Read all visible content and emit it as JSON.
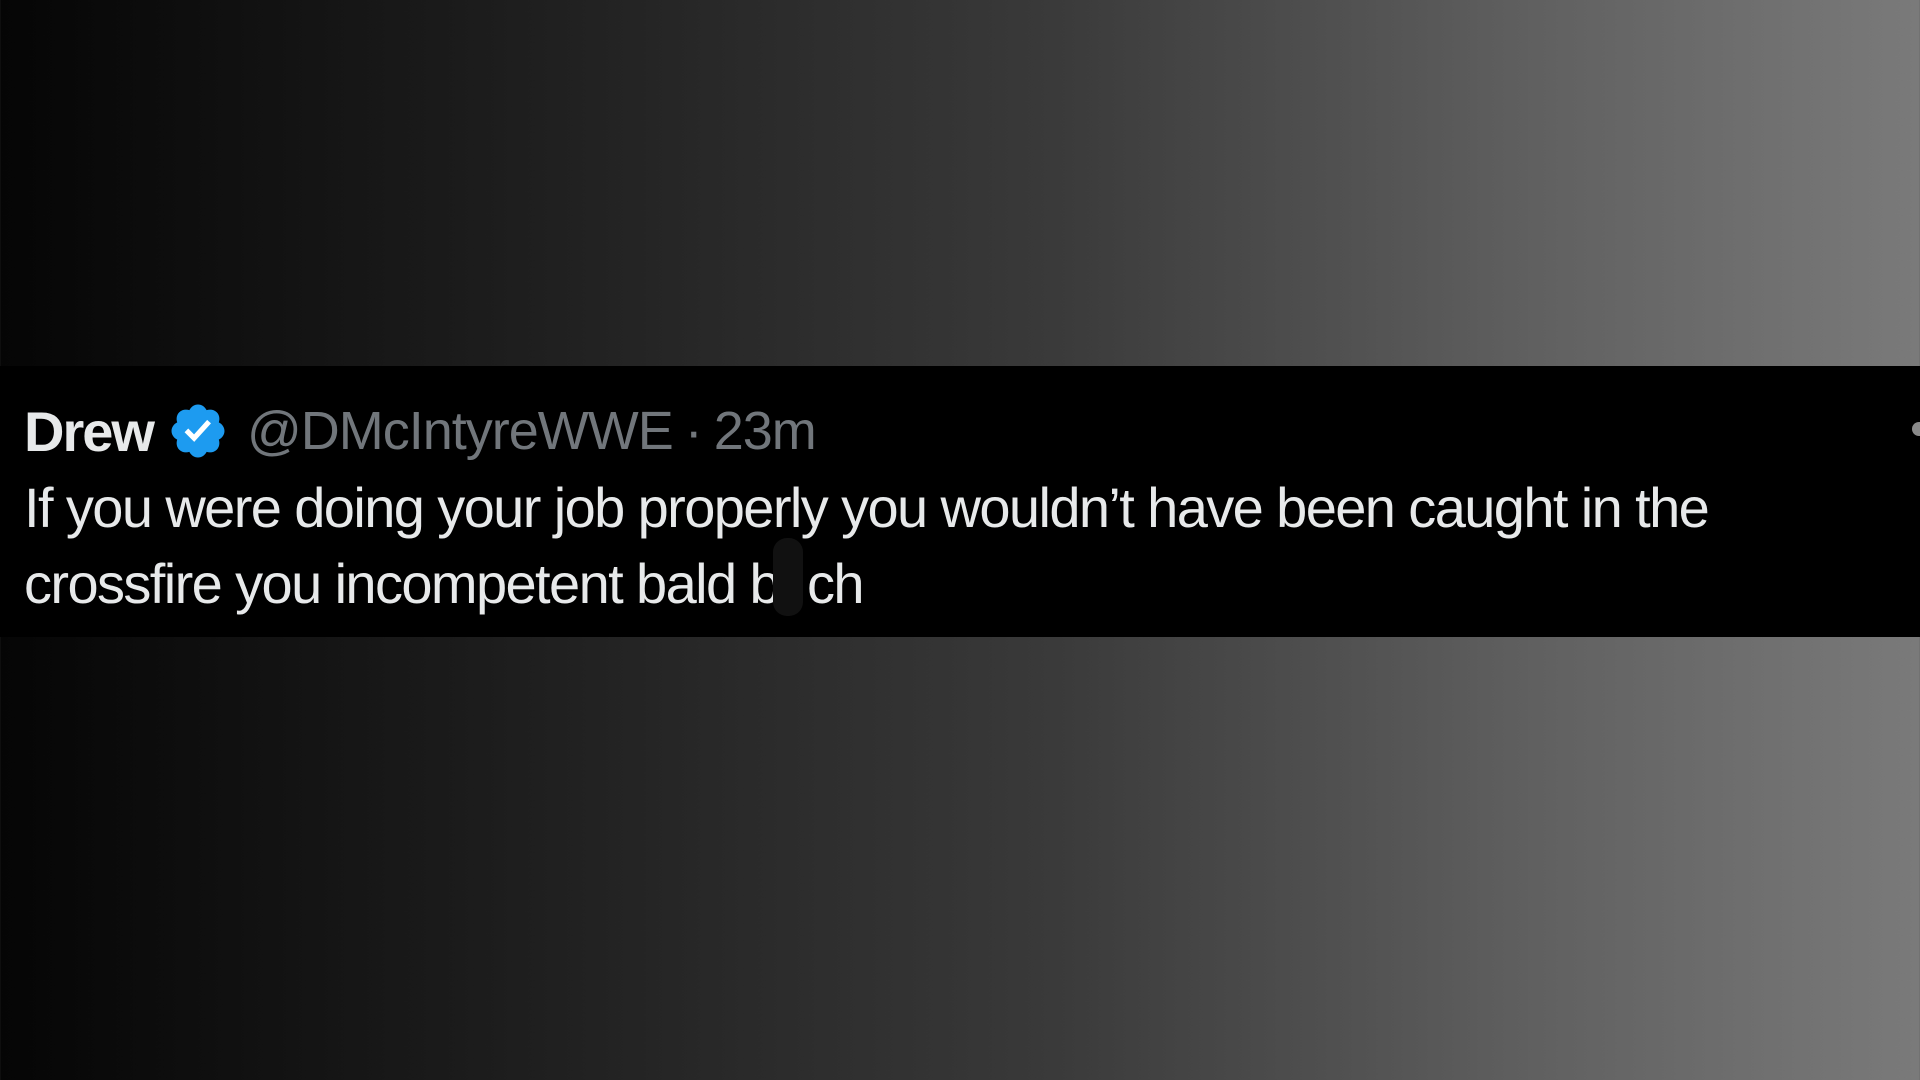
{
  "tweet": {
    "display_name": "Drew",
    "badge_icon": "verified-badge-icon",
    "badge_color": "#1d9bf0",
    "handle": "@DMcIntyreWWE",
    "separator": "·",
    "timestamp": "23m",
    "text_line_1": "If you were doing your job properly you wouldn’t have been caught in the",
    "text_line_2_a": "crossfire you incompetent bald b",
    "text_line_2_b": "ch"
  },
  "colors": {
    "card_background": "#000000",
    "text_primary": "#e7e9ea",
    "text_secondary": "#71767b"
  }
}
